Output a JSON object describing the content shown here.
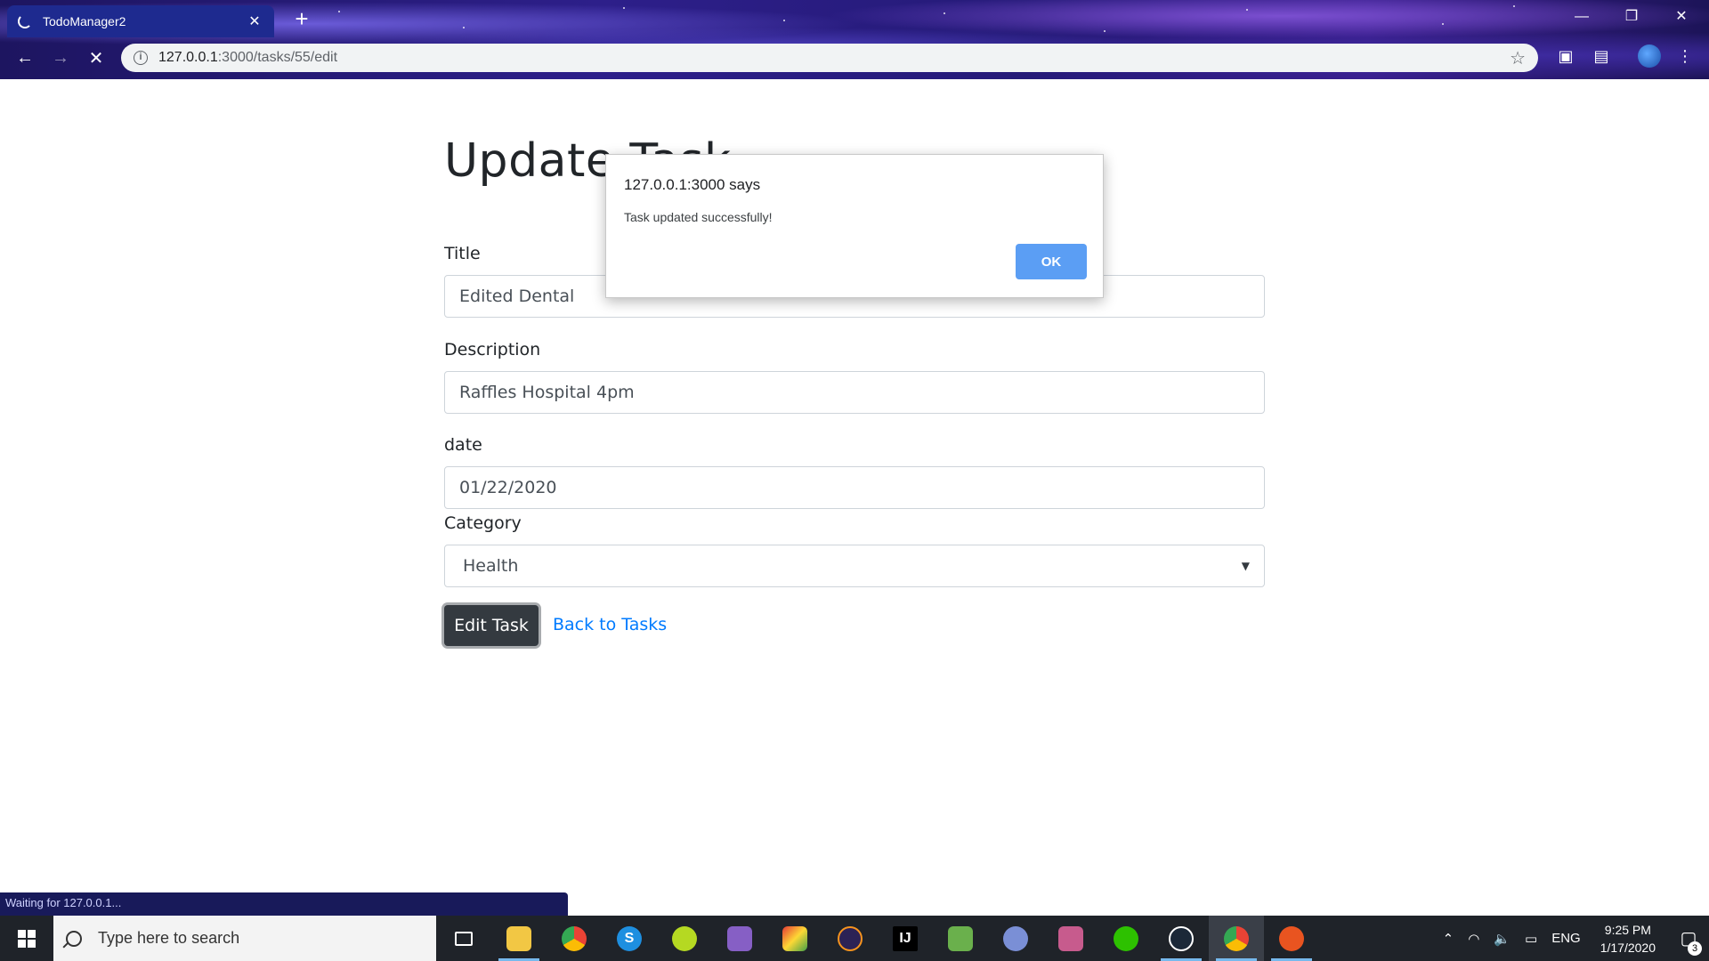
{
  "browser": {
    "tab_title": "TodoManager2",
    "tab_close": "✕",
    "new_tab": "+",
    "url_host": "127.0.0.1",
    "url_path": ":3000/tasks/55/edit",
    "window_controls": {
      "minimize": "—",
      "restore": "❐",
      "close": "✕"
    },
    "status_text": "Waiting for 127.0.0.1..."
  },
  "page": {
    "title": "Update Task",
    "fields": {
      "title_label": "Title",
      "title_value": "Edited Dental",
      "description_label": "Description",
      "description_value": "Raffles Hospital 4pm",
      "date_label": "date",
      "date_value": "01/22/2020",
      "category_label": "Category",
      "category_value": "Health"
    },
    "edit_button": "Edit Task",
    "back_link": "Back to Tasks"
  },
  "dialog": {
    "title": "127.0.0.1:3000 says",
    "message": "Task updated successfully!",
    "ok_label": "OK"
  },
  "taskbar": {
    "search_placeholder": "Type here to search",
    "language": "ENG",
    "time": "9:25 PM",
    "date": "1/17/2020",
    "notification_count": "3"
  },
  "colors": {
    "button_dark": "#343a40",
    "link_blue": "#007bff",
    "dialog_ok": "#5b9ef4",
    "taskbar_bg": "#1f2329"
  }
}
